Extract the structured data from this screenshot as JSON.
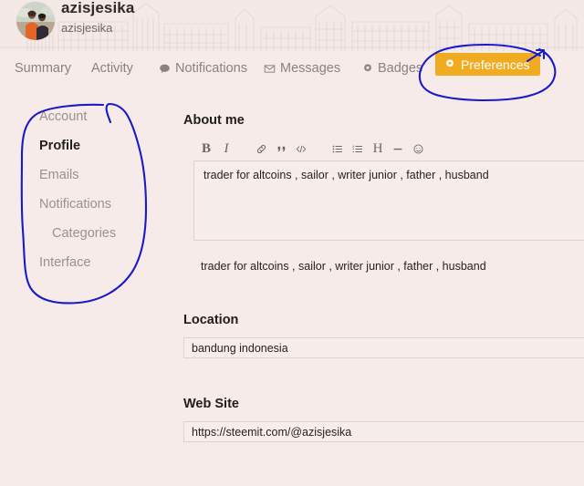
{
  "profile": {
    "display_name": "azisjesika",
    "handle": "azisjesika",
    "avatar_icon": "user-photo-avatar"
  },
  "nav": {
    "tabs": [
      {
        "label": "Summary",
        "icon": "",
        "active": false
      },
      {
        "label": "Activity",
        "icon": "",
        "active": false
      },
      {
        "label": "Notifications",
        "icon": "speech-bubble-icon",
        "active": false
      },
      {
        "label": "Messages",
        "icon": "envelope-icon",
        "active": false
      },
      {
        "label": "Badges",
        "icon": "badge-gear-icon",
        "active": false
      },
      {
        "label": "Preferences",
        "icon": "gear-icon",
        "active": true
      }
    ],
    "preferences_label": "Preferences"
  },
  "sidebar": {
    "items": [
      {
        "label": "Account",
        "active": false,
        "sub": false
      },
      {
        "label": "Profile",
        "active": true,
        "sub": false
      },
      {
        "label": "Emails",
        "active": false,
        "sub": false
      },
      {
        "label": "Notifications",
        "active": false,
        "sub": false
      },
      {
        "label": "Categories",
        "active": false,
        "sub": true
      },
      {
        "label": "Interface",
        "active": false,
        "sub": false
      }
    ]
  },
  "main": {
    "about": {
      "label": "About me",
      "value": "trader for altcoins , sailor , writer junior , father , husband",
      "preview": "trader for altcoins , sailor , writer junior , father , husband",
      "toolbar": [
        {
          "name": "bold-icon",
          "glyph": "B"
        },
        {
          "name": "italic-icon",
          "glyph": "I"
        },
        {
          "name": "link-icon",
          "glyph": "%"
        },
        {
          "name": "quote-icon",
          "glyph": "”"
        },
        {
          "name": "code-icon",
          "glyph": "</>"
        },
        {
          "name": "bullet-list-icon",
          "glyph": "≡"
        },
        {
          "name": "numbered-list-icon",
          "glyph": "≡"
        },
        {
          "name": "heading-icon",
          "glyph": "H"
        },
        {
          "name": "horizontal-rule-icon",
          "glyph": "–"
        },
        {
          "name": "emoji-icon",
          "glyph": "☺"
        }
      ]
    },
    "location": {
      "label": "Location",
      "value": "bandung indonesia",
      "placeholder": ""
    },
    "website": {
      "label": "Web Site",
      "value": "https://steemit.com/@azisjesika",
      "placeholder": ""
    }
  },
  "annotations": {
    "color": "#1a1ac8",
    "shapes": [
      "sidebar-circle",
      "preferences-circle-with-arrow"
    ]
  },
  "colors": {
    "page_background": "#f6ebe9",
    "banner_background": "#f4e9e7",
    "accent_button": "#f0ab20",
    "muted_text": "#8b817d",
    "dark_text": "#231f1e",
    "annotation_blue": "#1a1ac8"
  }
}
